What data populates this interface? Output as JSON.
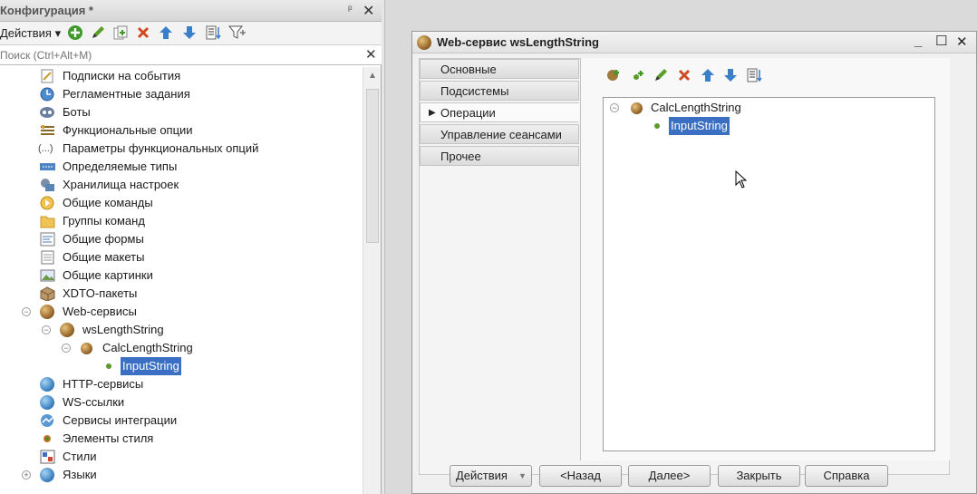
{
  "left_panel": {
    "title": "Конфигурация *",
    "pin_glyph": "ª",
    "close_glyph": "✕",
    "actions_label": "Действия ▾",
    "search_placeholder": "Поиск (Ctrl+Alt+M)",
    "tree": [
      {
        "label": "Подписки на события",
        "icon": "subscription-icon"
      },
      {
        "label": "Регламентные задания",
        "icon": "clock-icon"
      },
      {
        "label": "Боты",
        "icon": "bot-icon"
      },
      {
        "label": "Функциональные опции",
        "icon": "functional-options-icon"
      },
      {
        "label": "Параметры функциональных опций",
        "icon": "options-params-icon"
      },
      {
        "label": "Определяемые типы",
        "icon": "defined-types-icon"
      },
      {
        "label": "Хранилища настроек",
        "icon": "settings-storage-icon"
      },
      {
        "label": "Общие команды",
        "icon": "command-icon"
      },
      {
        "label": "Группы команд",
        "icon": "folder-icon"
      },
      {
        "label": "Общие формы",
        "icon": "form-icon"
      },
      {
        "label": "Общие макеты",
        "icon": "template-icon"
      },
      {
        "label": "Общие картинки",
        "icon": "picture-icon"
      },
      {
        "label": "XDTO-пакеты",
        "icon": "xdto-icon"
      },
      {
        "label": "Web-сервисы",
        "icon": "web-service-icon"
      },
      {
        "label": "wsLengthString",
        "icon": "web-service-icon"
      },
      {
        "label": "CalcLengthString",
        "icon": "operation-icon"
      },
      {
        "label": "InputString",
        "icon": "parameter-icon"
      },
      {
        "label": "HTTP-сервисы",
        "icon": "http-icon"
      },
      {
        "label": "WS-ссылки",
        "icon": "ws-link-icon"
      },
      {
        "label": "Сервисы интеграции",
        "icon": "integration-icon"
      },
      {
        "label": "Элементы стиля",
        "icon": "style-element-icon"
      },
      {
        "label": "Стили",
        "icon": "style-icon"
      },
      {
        "label": "Языки",
        "icon": "language-icon"
      }
    ]
  },
  "dialog": {
    "title": "Web-сервис wsLengthString",
    "tabs": [
      "Основные",
      "Подсистемы",
      "Операции",
      "Управление сеансами",
      "Прочее"
    ],
    "active_tab": "Операции",
    "op_tree": {
      "operation": "CalcLengthString",
      "parameter": "InputString"
    },
    "buttons": {
      "actions": "Действия",
      "back": "<Назад",
      "next": "Далее>",
      "close": "Закрыть",
      "help": "Справка"
    }
  },
  "colors": {
    "selection": "#3a6fc4",
    "add_green": "#3f9a2a",
    "delete_red": "#d04a22",
    "arrow_blue": "#3a7fc8"
  }
}
